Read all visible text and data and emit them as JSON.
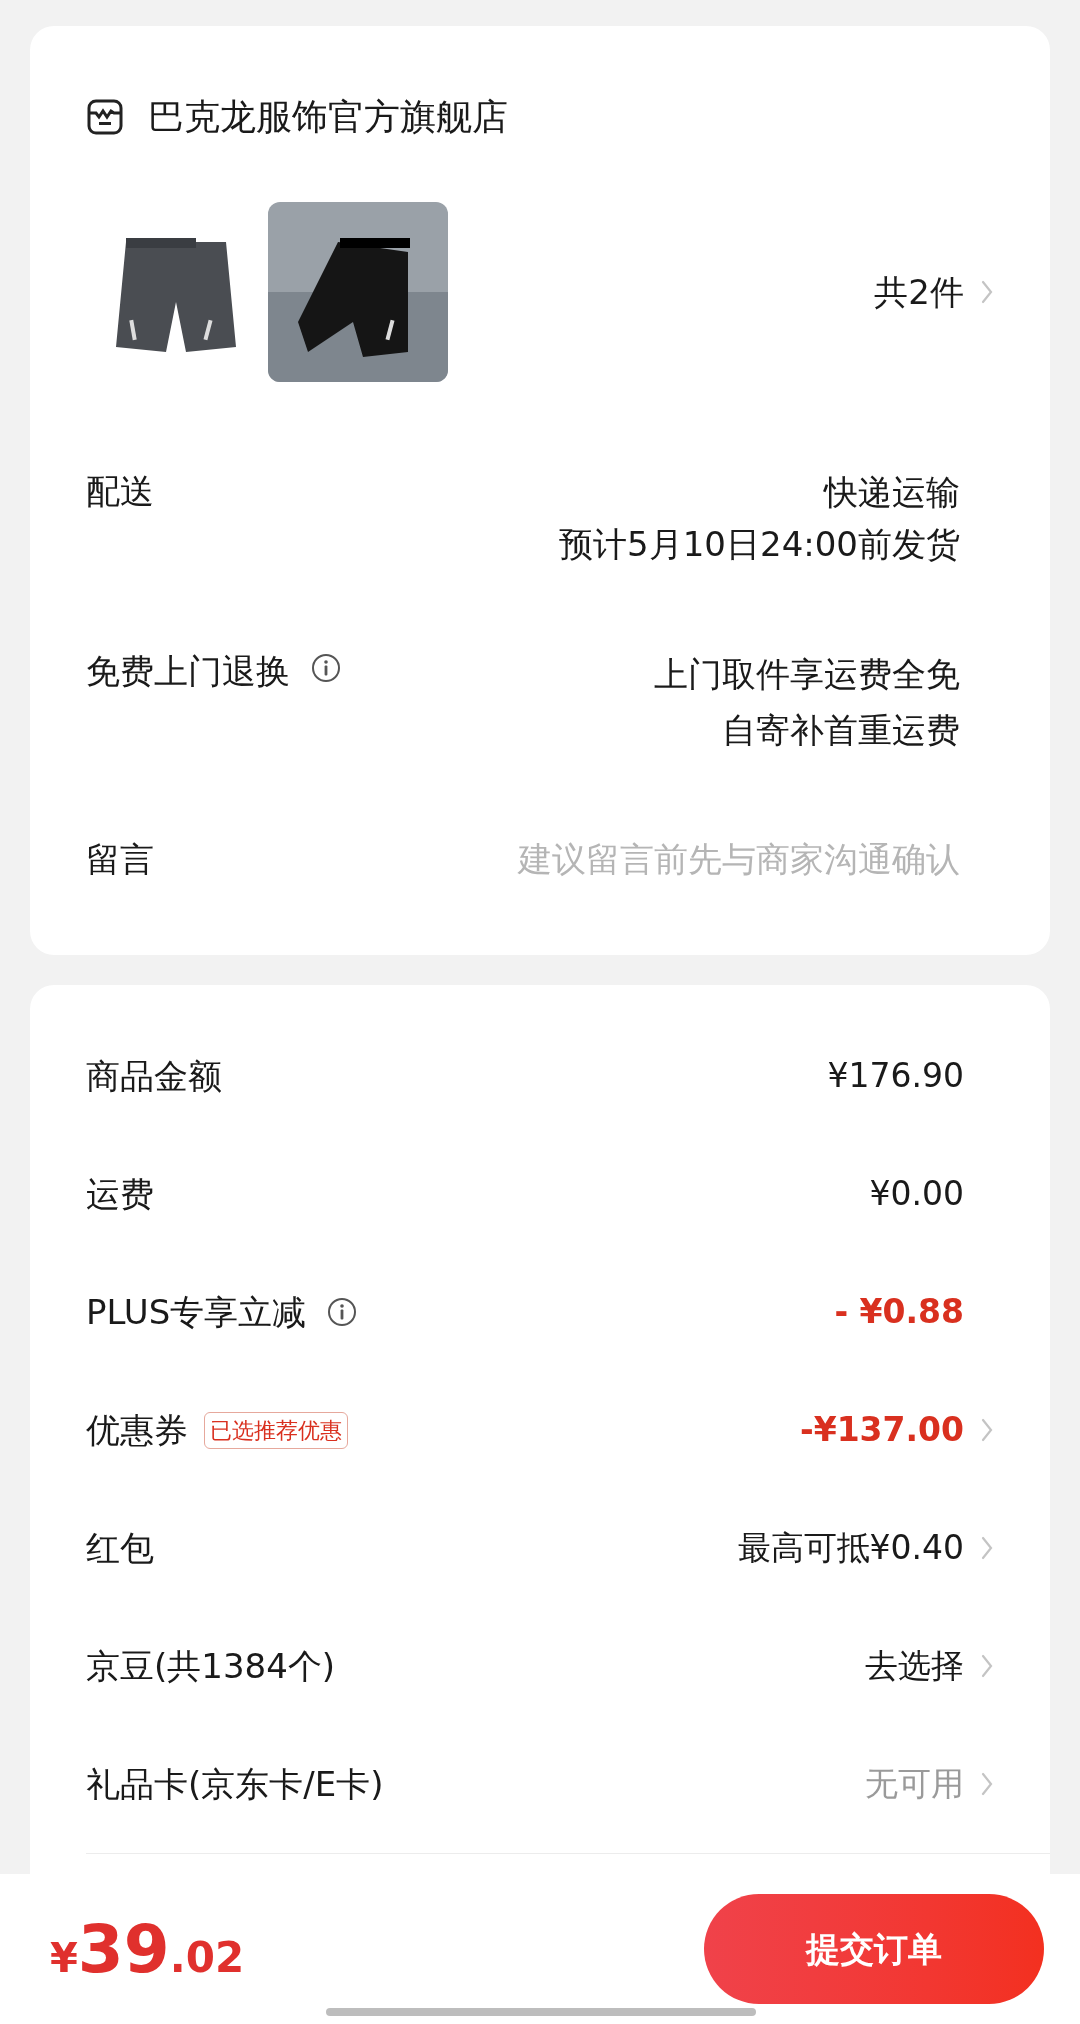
{
  "store": {
    "name": "巴克龙服饰官方旗舰店"
  },
  "products": [
    {
      "kind": "picture",
      "framed": false
    },
    {
      "kind": "picture",
      "framed": true
    }
  ],
  "item_count": "共2件",
  "delivery": {
    "label": "配送",
    "lines": [
      "快递运输",
      "预计5月10日24:00前发货"
    ]
  },
  "returns": {
    "label": "免费上门退换",
    "info": true,
    "lines": [
      "上门取件享运费全免",
      "自寄补首重运费"
    ]
  },
  "message": {
    "label": "留言",
    "placeholder": "建议留言前先与商家沟通确认"
  },
  "fees": [
    {
      "label": "商品金额",
      "value": "¥176.90",
      "discount": false,
      "muted": false,
      "info": false,
      "chevron": false
    },
    {
      "label": "运费",
      "value": "¥0.00",
      "discount": false,
      "muted": false,
      "info": false,
      "chevron": false
    },
    {
      "label": "PLUS专享立减",
      "value": "- ¥0.88",
      "discount": true,
      "muted": false,
      "info": true,
      "chevron": false
    },
    {
      "label": "优惠券",
      "badge": "已选推荐优惠",
      "value": "-¥137.00",
      "discount": true,
      "muted": false,
      "info": false,
      "chevron": true
    },
    {
      "label": "红包",
      "value": "最高可抵¥0.40",
      "discount": false,
      "muted": false,
      "info": false,
      "chevron": true
    },
    {
      "label": "京豆(共1384个)",
      "value": "去选择",
      "discount": false,
      "muted": false,
      "info": false,
      "chevron": true
    },
    {
      "label": "礼品卡(京东卡/E卡)",
      "value": "无可用",
      "discount": false,
      "muted": true,
      "info": false,
      "chevron": true
    }
  ],
  "total": {
    "currency": "¥",
    "integer": "39",
    "decimal": ".02"
  },
  "submit": "提交订单"
}
